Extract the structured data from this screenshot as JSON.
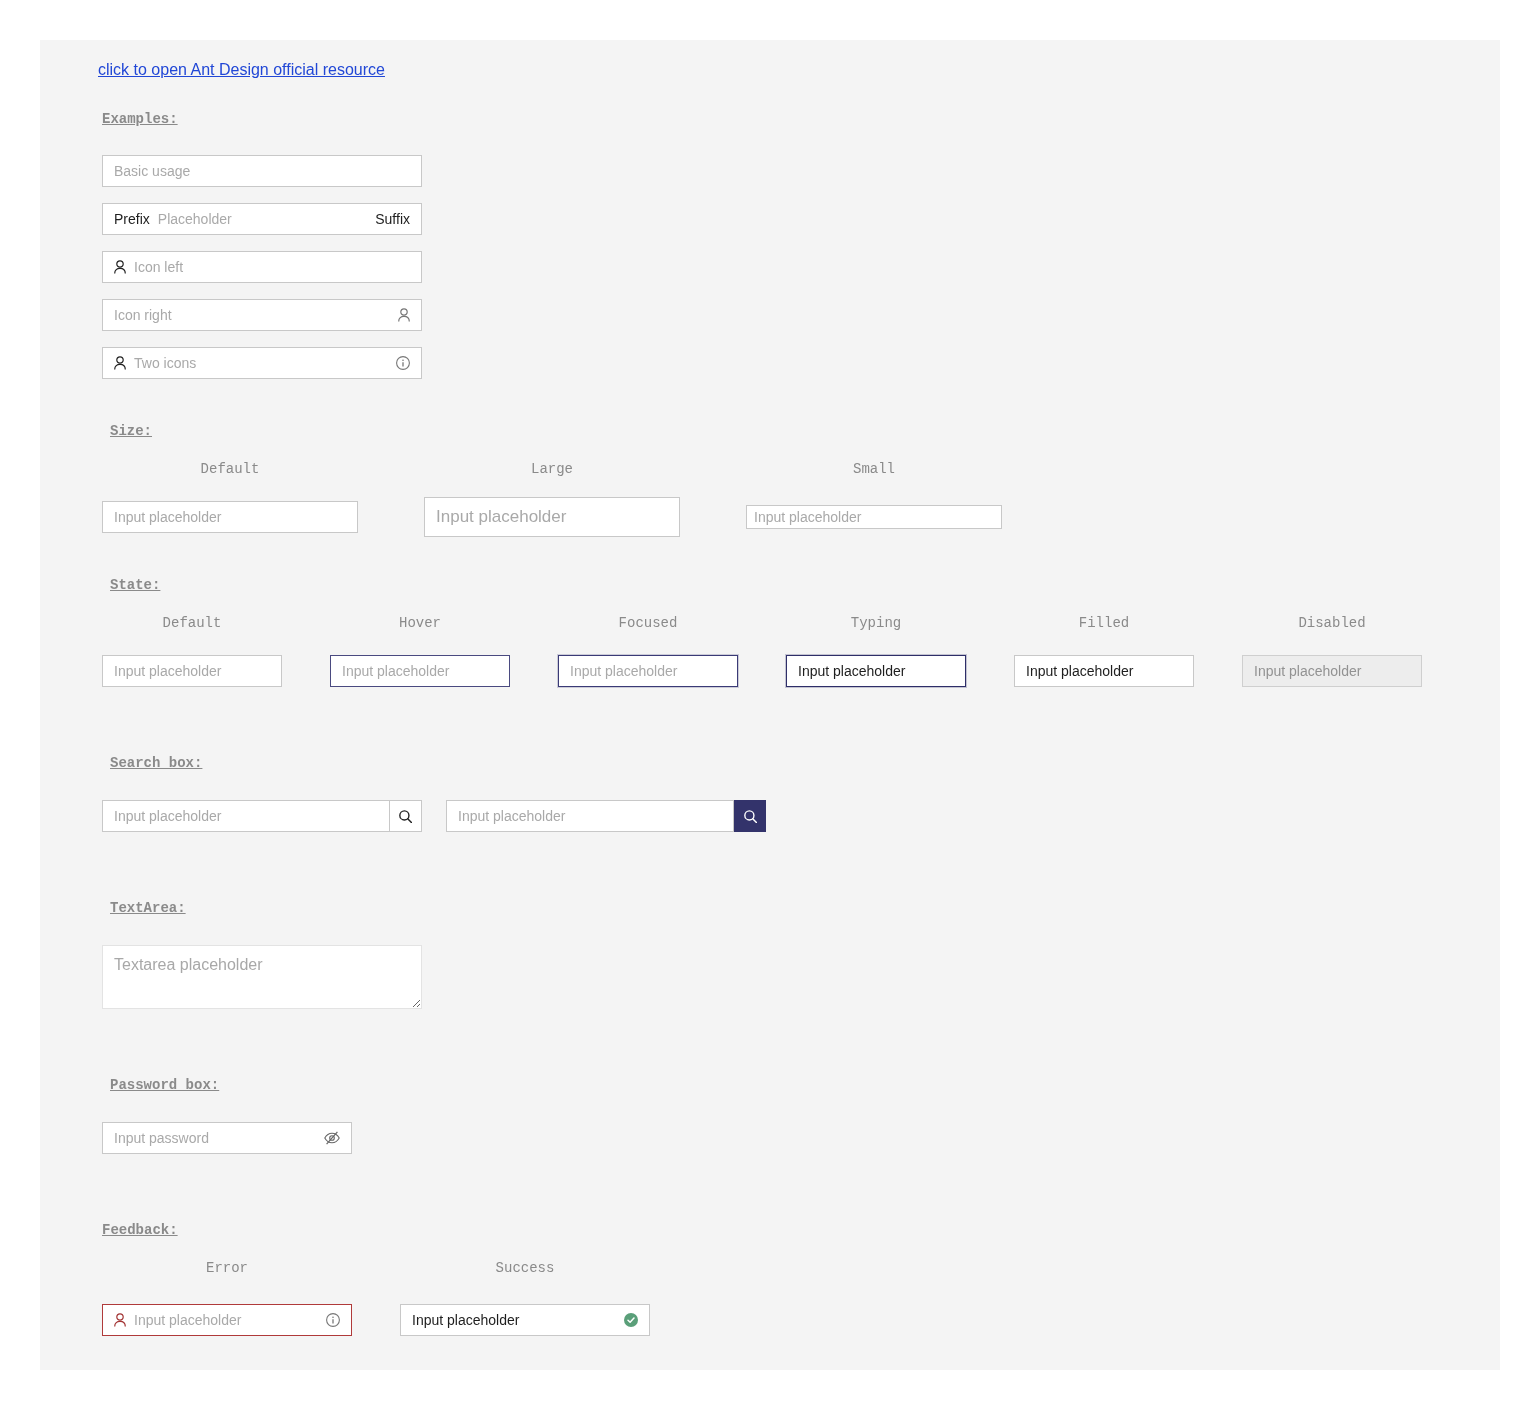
{
  "link": {
    "text": "click to open Ant Design official resource"
  },
  "examples": {
    "heading": "Examples:",
    "inputs": [
      {
        "kind": "basic",
        "placeholder": "Basic usage"
      },
      {
        "kind": "affix",
        "prefix": "Prefix",
        "placeholder": "Placeholder",
        "suffix": "Suffix"
      },
      {
        "kind": "icon_left",
        "placeholder": "Icon left"
      },
      {
        "kind": "icon_right",
        "placeholder": "Icon right"
      },
      {
        "kind": "two_icons",
        "placeholder": "Two icons"
      }
    ]
  },
  "size": {
    "heading": "Size:",
    "items": [
      {
        "label": "Default",
        "kind": "default",
        "placeholder": "Input placeholder"
      },
      {
        "label": "Large",
        "kind": "large",
        "placeholder": "Input placeholder"
      },
      {
        "label": "Small",
        "kind": "small",
        "placeholder": "Input placeholder"
      }
    ]
  },
  "state": {
    "heading": "State:",
    "items": [
      {
        "label": "Default",
        "kind": "default",
        "placeholder": "Input placeholder"
      },
      {
        "label": "Hover",
        "kind": "hover",
        "placeholder": "Input placeholder"
      },
      {
        "label": "Focused",
        "kind": "focused",
        "placeholder": "Input placeholder"
      },
      {
        "label": "Typing",
        "kind": "typing",
        "value": "Input placeholder"
      },
      {
        "label": "Filled",
        "kind": "filled",
        "value": "Input placeholder"
      },
      {
        "label": "Disabled",
        "kind": "disabled",
        "placeholder": "Input placeholder"
      }
    ]
  },
  "search": {
    "heading": "Search box:",
    "items": [
      {
        "kind": "outline_button",
        "placeholder": "Input placeholder"
      },
      {
        "kind": "filled_button",
        "placeholder": "Input placeholder"
      }
    ]
  },
  "textarea": {
    "heading": "TextArea:",
    "placeholder": "Textarea placeholder"
  },
  "password": {
    "heading": "Password box:",
    "placeholder": "Input password"
  },
  "feedback": {
    "heading": "Feedback:",
    "items": [
      {
        "label": "Error",
        "kind": "error",
        "placeholder": "Input placeholder"
      },
      {
        "label": "Success",
        "kind": "success",
        "value": "Input placeholder"
      }
    ]
  }
}
